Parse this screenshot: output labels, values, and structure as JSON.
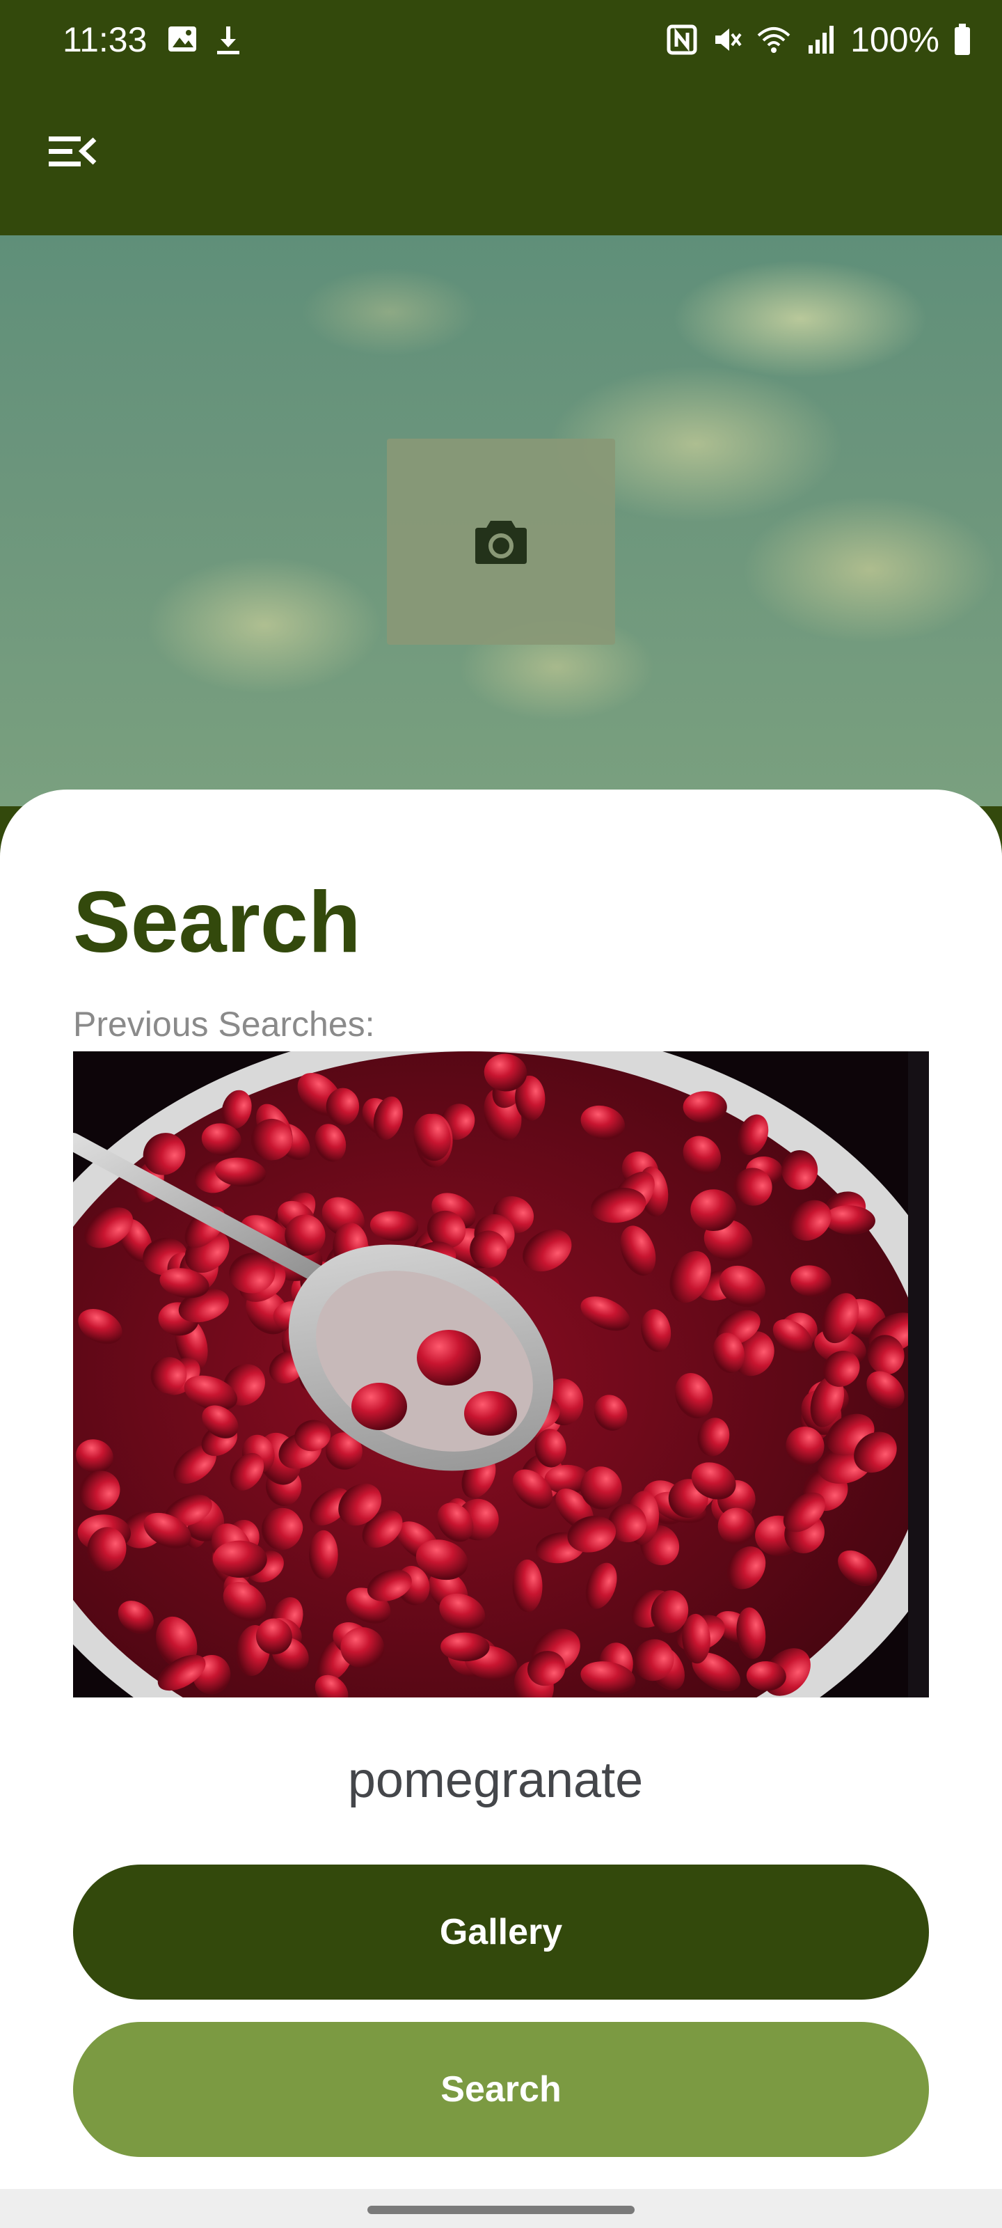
{
  "status_bar": {
    "time": "11:33",
    "battery": "100%",
    "icons_left": [
      "image-icon",
      "download-icon"
    ],
    "icons_right": [
      "nfc-icon",
      "mute-icon",
      "wifi-icon",
      "signal-icon",
      "battery-icon"
    ]
  },
  "app_bar": {
    "menu_icon": "menu-collapse-icon"
  },
  "hero": {
    "camera_icon": "camera-icon"
  },
  "search": {
    "title": "Search",
    "previous_label": "Previous Searches:",
    "result_label": "pomegranate",
    "gallery_button": "Gallery",
    "search_button": "Search"
  },
  "colors": {
    "primary": "#33490c",
    "secondary": "#7b9a42",
    "surface": "#ffffff",
    "muted_text": "#8a8a8a"
  }
}
